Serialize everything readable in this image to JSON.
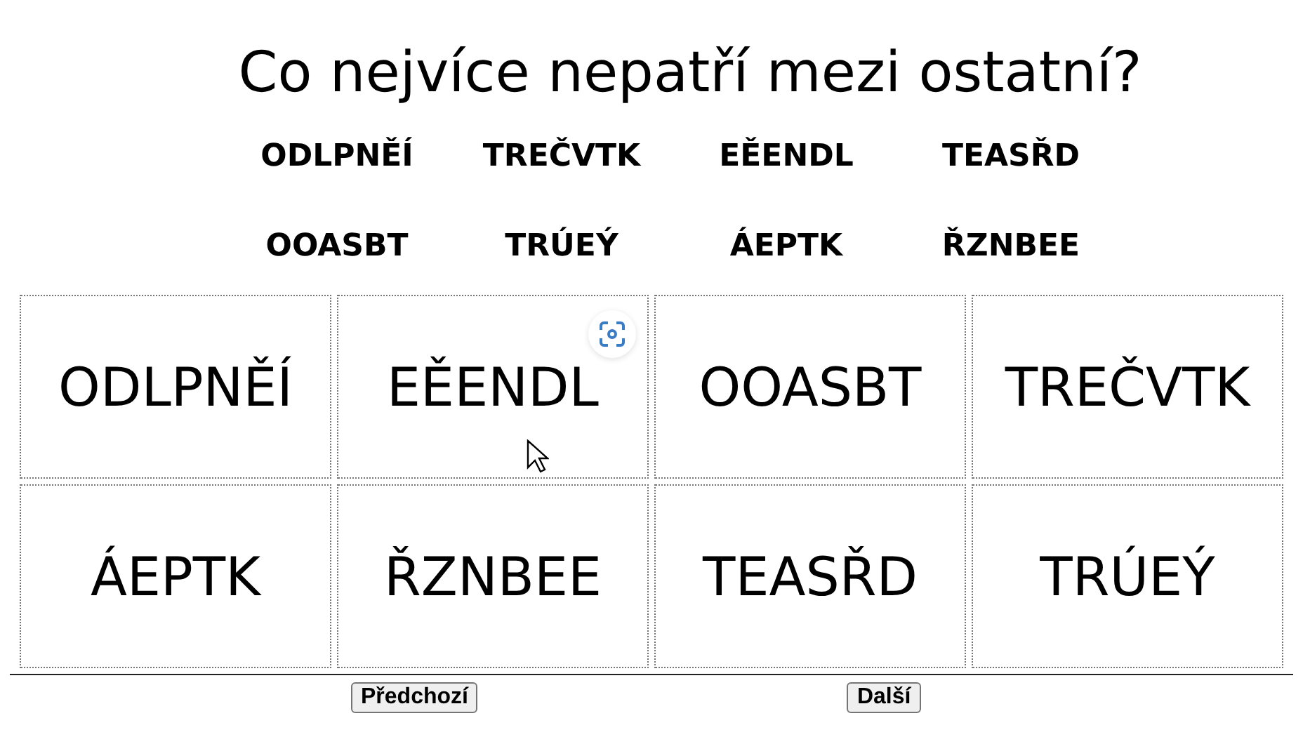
{
  "question": "Co nejvíce nepatří mezi ostatní?",
  "word_bank": [
    "ODLPNĚÍ",
    "TREČVTK",
    "EĚENDL",
    "TEASŘD",
    "OOASBT",
    "TRÚEÝ",
    "ÁEPTK",
    "ŘZNBEE"
  ],
  "cards": [
    "ODLPNĚÍ",
    "EĚENDL",
    "OOASBT",
    "TREČVTK",
    "ÁEPTK",
    "ŘZNBEE",
    "TEASŘD",
    "TRÚEÝ"
  ],
  "buttons": [
    "Předchozí",
    "Další"
  ]
}
